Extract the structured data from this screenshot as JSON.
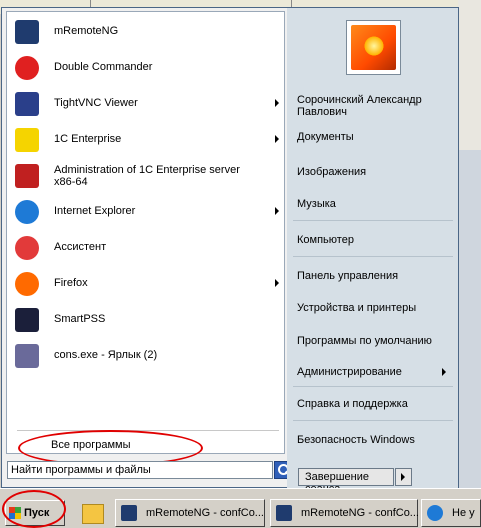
{
  "programs": [
    {
      "label": "mRemoteNG",
      "icon": "mremoteng-icon",
      "color": "#1f3b6e",
      "has_arrow": false
    },
    {
      "label": "Double Commander",
      "icon": "double-commander-icon",
      "color": "#e02020",
      "has_arrow": false
    },
    {
      "label": "TightVNC Viewer",
      "icon": "tightvnc-icon",
      "color": "#2a3f8a",
      "has_arrow": true
    },
    {
      "label": "1C Enterprise",
      "icon": "1c-icon",
      "color": "#f5d400",
      "has_arrow": true
    },
    {
      "label": "Administration of 1C Enterprise server x86-64",
      "icon": "1c-server-icon",
      "color": "#c02020",
      "has_arrow": false
    },
    {
      "label": "Internet Explorer",
      "icon": "internet-explorer-icon",
      "color": "#1e7ad6",
      "has_arrow": true
    },
    {
      "label": "Ассистент",
      "icon": "assistant-icon",
      "color": "#e23a3a",
      "has_arrow": false
    },
    {
      "label": "Firefox",
      "icon": "firefox-icon",
      "color": "#ff6a00",
      "has_arrow": true
    },
    {
      "label": "SmartPSS",
      "icon": "smartpss-icon",
      "color": "#1b1f3a",
      "has_arrow": false
    },
    {
      "label": "cons.exe - Ярлык (2)",
      "icon": "cons-exe-icon",
      "color": "#6a6a9a",
      "has_arrow": false
    }
  ],
  "all_programs": "Все программы",
  "search": {
    "placeholder": "Найти программы и файлы"
  },
  "right_links": [
    {
      "label": "Сорочинский Александр Павлович",
      "has_arrow": false
    },
    {
      "label": "Документы",
      "has_arrow": false
    },
    {
      "label": "Изображения",
      "has_arrow": false
    },
    {
      "label": "Музыка",
      "has_arrow": false
    },
    {
      "label": "Компьютер",
      "has_arrow": false
    },
    {
      "label": "Панель управления",
      "has_arrow": false
    },
    {
      "label": "Устройства и принтеры",
      "has_arrow": false
    },
    {
      "label": "Программы по умолчанию",
      "has_arrow": false
    },
    {
      "label": "Администрирование",
      "has_arrow": true
    },
    {
      "label": "Справка и поддержка",
      "has_arrow": false
    },
    {
      "label": "Безопасность Windows",
      "has_arrow": false
    }
  ],
  "shutdown": {
    "label": "Завершение сеанса"
  },
  "taskbar": {
    "start_label": "Пуск",
    "tasks": [
      {
        "label": "mRemoteNG - confCo...",
        "icon": "mremoteng-icon"
      },
      {
        "label": "mRemoteNG - confCo...",
        "icon": "mremoteng-icon"
      },
      {
        "label": "Не у",
        "icon": "internet-explorer-icon"
      }
    ]
  },
  "colors": {
    "highlight_ellipse": "#e00000",
    "menu_border": "#4b6686",
    "right_pane": "#d6dfe6"
  }
}
